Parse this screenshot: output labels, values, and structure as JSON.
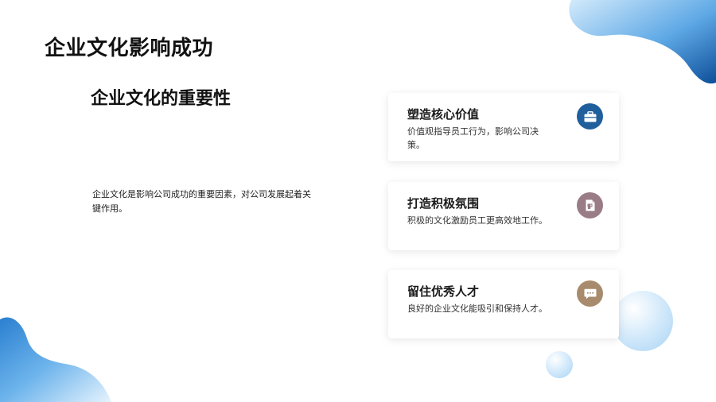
{
  "page": {
    "title": "企业文化影响成功",
    "subtitle": "企业文化的重要性",
    "description": "企业文化是影响公司成功的重要因素，对公司发展起着关键作用。"
  },
  "cards": [
    {
      "title": "塑造核心价值",
      "text": "价值观指导员工行为，影响公司决策。",
      "icon": "briefcase-icon",
      "icon_color": "#1f5f9c"
    },
    {
      "title": "打造积极氛围",
      "text": "积极的文化激励员工更高效地工作。",
      "icon": "document-icon",
      "icon_color": "#9a7c86"
    },
    {
      "title": "留住优秀人才",
      "text": "良好的企业文化能吸引和保持人才。",
      "icon": "chat-bubble-icon",
      "icon_color": "#a88a6c"
    }
  ],
  "colors": {
    "accent_blue": "#1f6fb8",
    "light_blue": "#a9d3f4"
  }
}
